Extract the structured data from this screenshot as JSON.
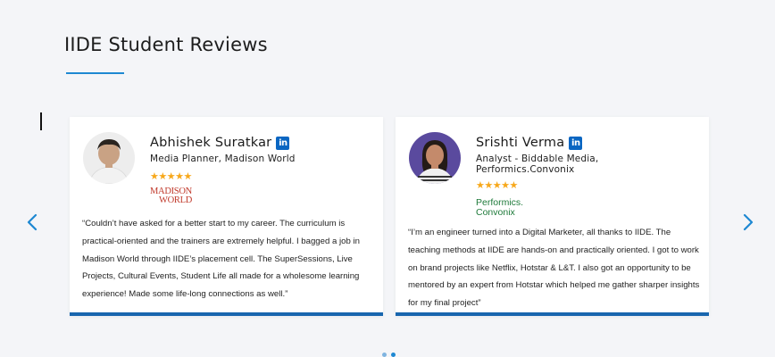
{
  "section": {
    "title": "IIDE Student Reviews"
  },
  "colors": {
    "accent": "#1e88d2",
    "card_border": "#1866ae",
    "stars": "#f7a81b",
    "linkedin": "#0a66c2"
  },
  "navigation": {
    "prev_icon": "chevron-left-icon",
    "next_icon": "chevron-right-icon"
  },
  "reviews": [
    {
      "name": "Abhishek Suratkar",
      "linkedin_icon_text": "in",
      "role": "Media Planner, Madison World",
      "rating": 5,
      "stars": "★★★★★",
      "company_logo": {
        "line1": "MADISON",
        "line2": "WORLD"
      },
      "quote": "“Couldn’t have asked for a better start to my career. The curriculum is practical-oriented and the trainers are extremely helpful. I bagged a job in Madison World through IIDE’s placement cell. The SuperSessions, Live Projects, Cultural Events, Student Life all made for a wholesome learning experience! Made some life-long connections as well.”"
    },
    {
      "name": "Srishti Verma",
      "linkedin_icon_text": "in",
      "role": "Analyst - Biddable Media, Performics.Convonix",
      "rating": 5,
      "stars": "★★★★★",
      "company_logo": {
        "line1": "Performics.",
        "line2": "Convonix"
      },
      "quote": "“I’m an engineer turned into a Digital Marketer, all thanks to IIDE. The teaching methods at IIDE are hands-on and practically oriented. I got to work on brand projects like Netflix, Hotstar & L&T. I also got an opportunity to be mentored by an expert from Hotstar which helped me gather sharper insights for my final project”"
    }
  ],
  "pagination": {
    "active_index": 1
  }
}
